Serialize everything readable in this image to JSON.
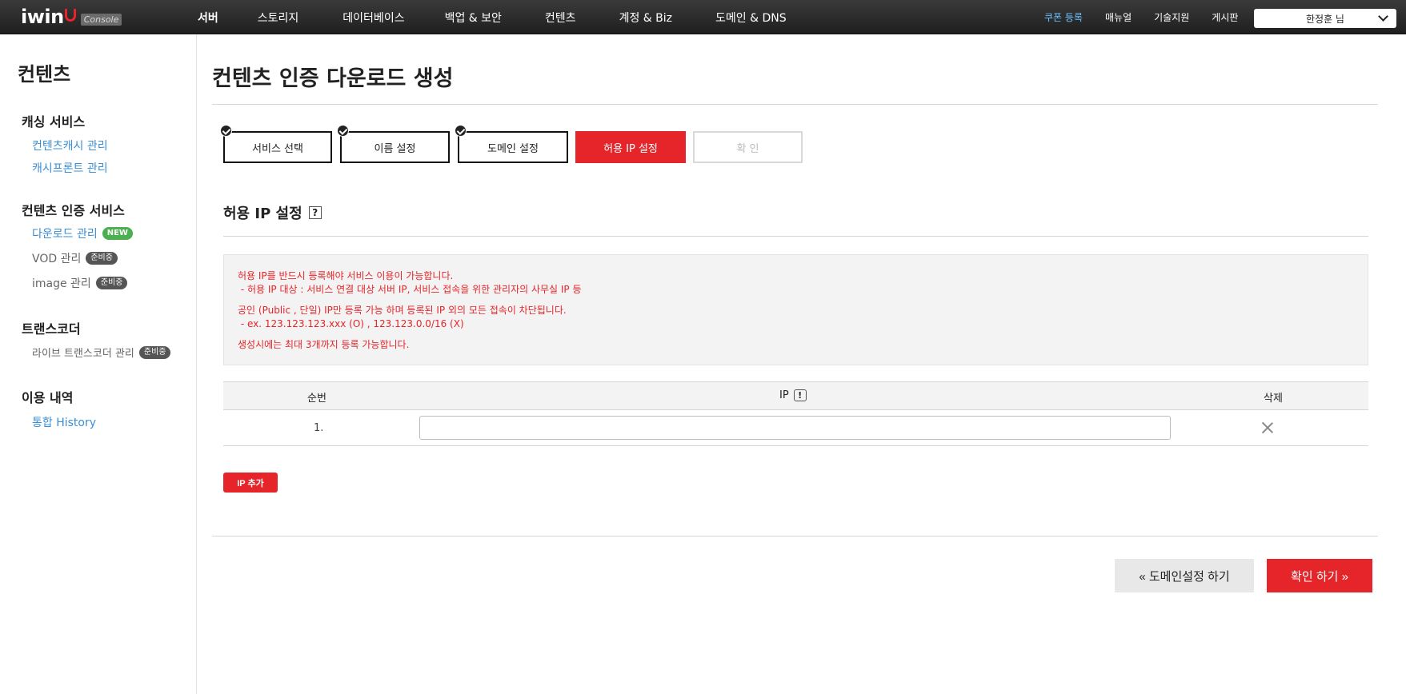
{
  "header": {
    "logo_text": "iwin",
    "logo_badge": "Console",
    "nav": [
      "서버",
      "스토리지",
      "데이터베이스",
      "백업 & 보안",
      "컨텐츠",
      "계정 & Biz",
      "도메인 & DNS"
    ],
    "util": [
      "쿠폰 등록",
      "매뉴얼",
      "기술지원",
      "게시판"
    ],
    "user": "한정훈 님"
  },
  "sidebar": {
    "title": "컨텐츠",
    "sections": [
      {
        "title": "캐싱 서비스",
        "items": [
          {
            "label": "컨텐츠캐시 관리",
            "badge": ""
          },
          {
            "label": "캐시프론트 관리",
            "badge": ""
          }
        ]
      },
      {
        "title": "컨텐츠 인증 서비스",
        "items": [
          {
            "label": "다운로드 관리",
            "badge": "NEW"
          },
          {
            "label": "VOD 관리",
            "badge": "준비중"
          },
          {
            "label": "image 관리",
            "badge": "준비중"
          }
        ]
      },
      {
        "title": "트랜스코더",
        "items": [
          {
            "label": "라이브 트랜스코더 관리",
            "badge": "준비중"
          }
        ]
      },
      {
        "title": "이용 내역",
        "items": [
          {
            "label": "통합 History",
            "badge": ""
          }
        ]
      }
    ]
  },
  "page": {
    "title": "컨텐츠 인증 다운로드 생성",
    "steps": [
      {
        "label": "서비스 선택",
        "state": "done"
      },
      {
        "label": "이름 설정",
        "state": "done"
      },
      {
        "label": "도메인 설정",
        "state": "done"
      },
      {
        "label": "허용 IP 설정",
        "state": "active"
      },
      {
        "label": "확 인",
        "state": "pending"
      }
    ],
    "section_title": "허용 IP 설정",
    "help_icon": "?",
    "notice": [
      "허용 IP를 반드시 등록해야 서비스 이용이 가능합니다.",
      " - 허용 IP 대상 : 서비스 연결 대상 서버 IP, 서비스 접속을 위한 관리자의 사무실 IP 등",
      "공인 (Public , 단일) IP만 등록 가능 하며 등록된 IP 외의 모든 접속이 차단됩니다.",
      " - ex. 123.123.123.xxx (O) , 123.123.0.0/16 (X)",
      "생성시에는 최대 3개까지 등록 가능합니다."
    ],
    "table": {
      "headers": [
        "순번",
        "IP",
        "삭제"
      ],
      "ip_header_icon": "!",
      "rows": [
        {
          "num": "1.",
          "ip": ""
        }
      ]
    },
    "add_button": "IP 추가",
    "prev_button": "« 도메인설정 하기",
    "next_button": "확인 하기 »"
  },
  "colors": {
    "accent": "#e5252a",
    "link": "#3b8fd6",
    "new_badge": "#4caf50"
  }
}
